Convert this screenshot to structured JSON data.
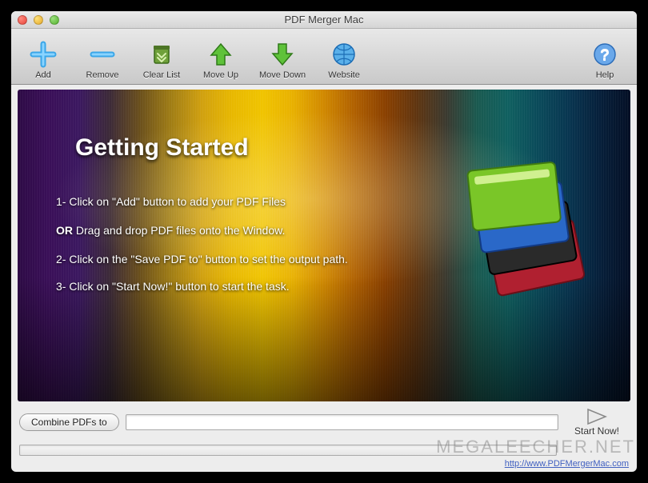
{
  "window": {
    "title": "PDF Merger Mac"
  },
  "toolbar": {
    "add": "Add",
    "remove": "Remove",
    "clearList": "Clear List",
    "moveUp": "Move Up",
    "moveDown": "Move Down",
    "website": "Website",
    "help": "Help"
  },
  "content": {
    "heading": "Getting Started",
    "step1": "1- Click on \"Add\" button to add your PDF Files",
    "step2_prefix": "OR",
    "step2_rest": " Drag and drop PDF files onto the Window.",
    "step3": "2- Click on the \"Save PDF to\" button to set the output path.",
    "step4": "3- Click on \"Start Now!\" button to start the task."
  },
  "bottom": {
    "combineLabel": "Combine PDFs to",
    "pathValue": "",
    "startLabel": "Start Now!"
  },
  "footer": {
    "link": "http://www.PDFMergerMac.com"
  },
  "watermark": "MEGALEECHER.NET"
}
